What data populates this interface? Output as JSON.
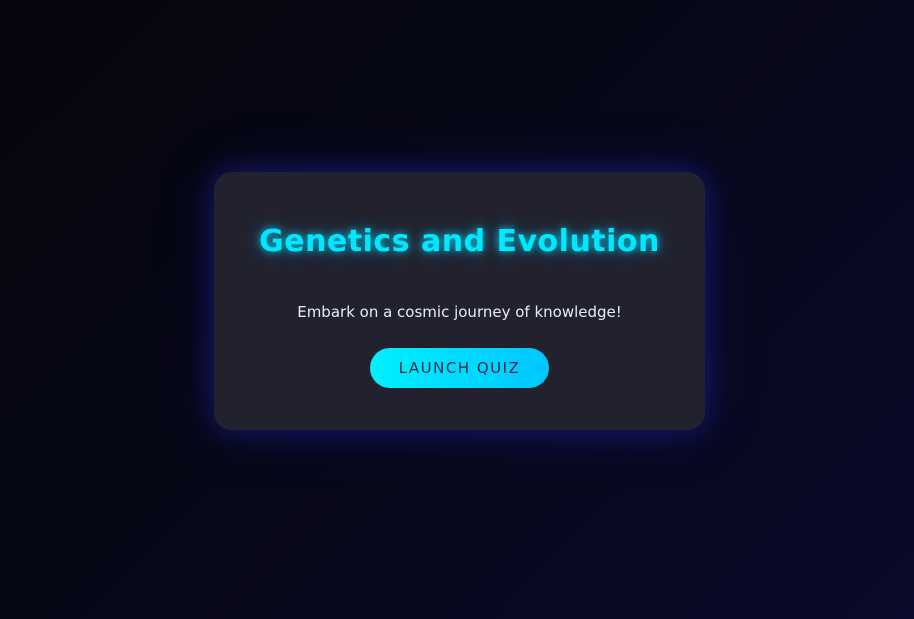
{
  "card": {
    "title": "Genetics and Evolution",
    "subtitle": "Embark on a cosmic journey of knowledge!",
    "button_label": "LAUNCH QUIZ"
  },
  "colors": {
    "accent": "#00e8ff",
    "card_background": "#22222f",
    "page_background": "#070817",
    "button_text": "#1b2a45"
  }
}
